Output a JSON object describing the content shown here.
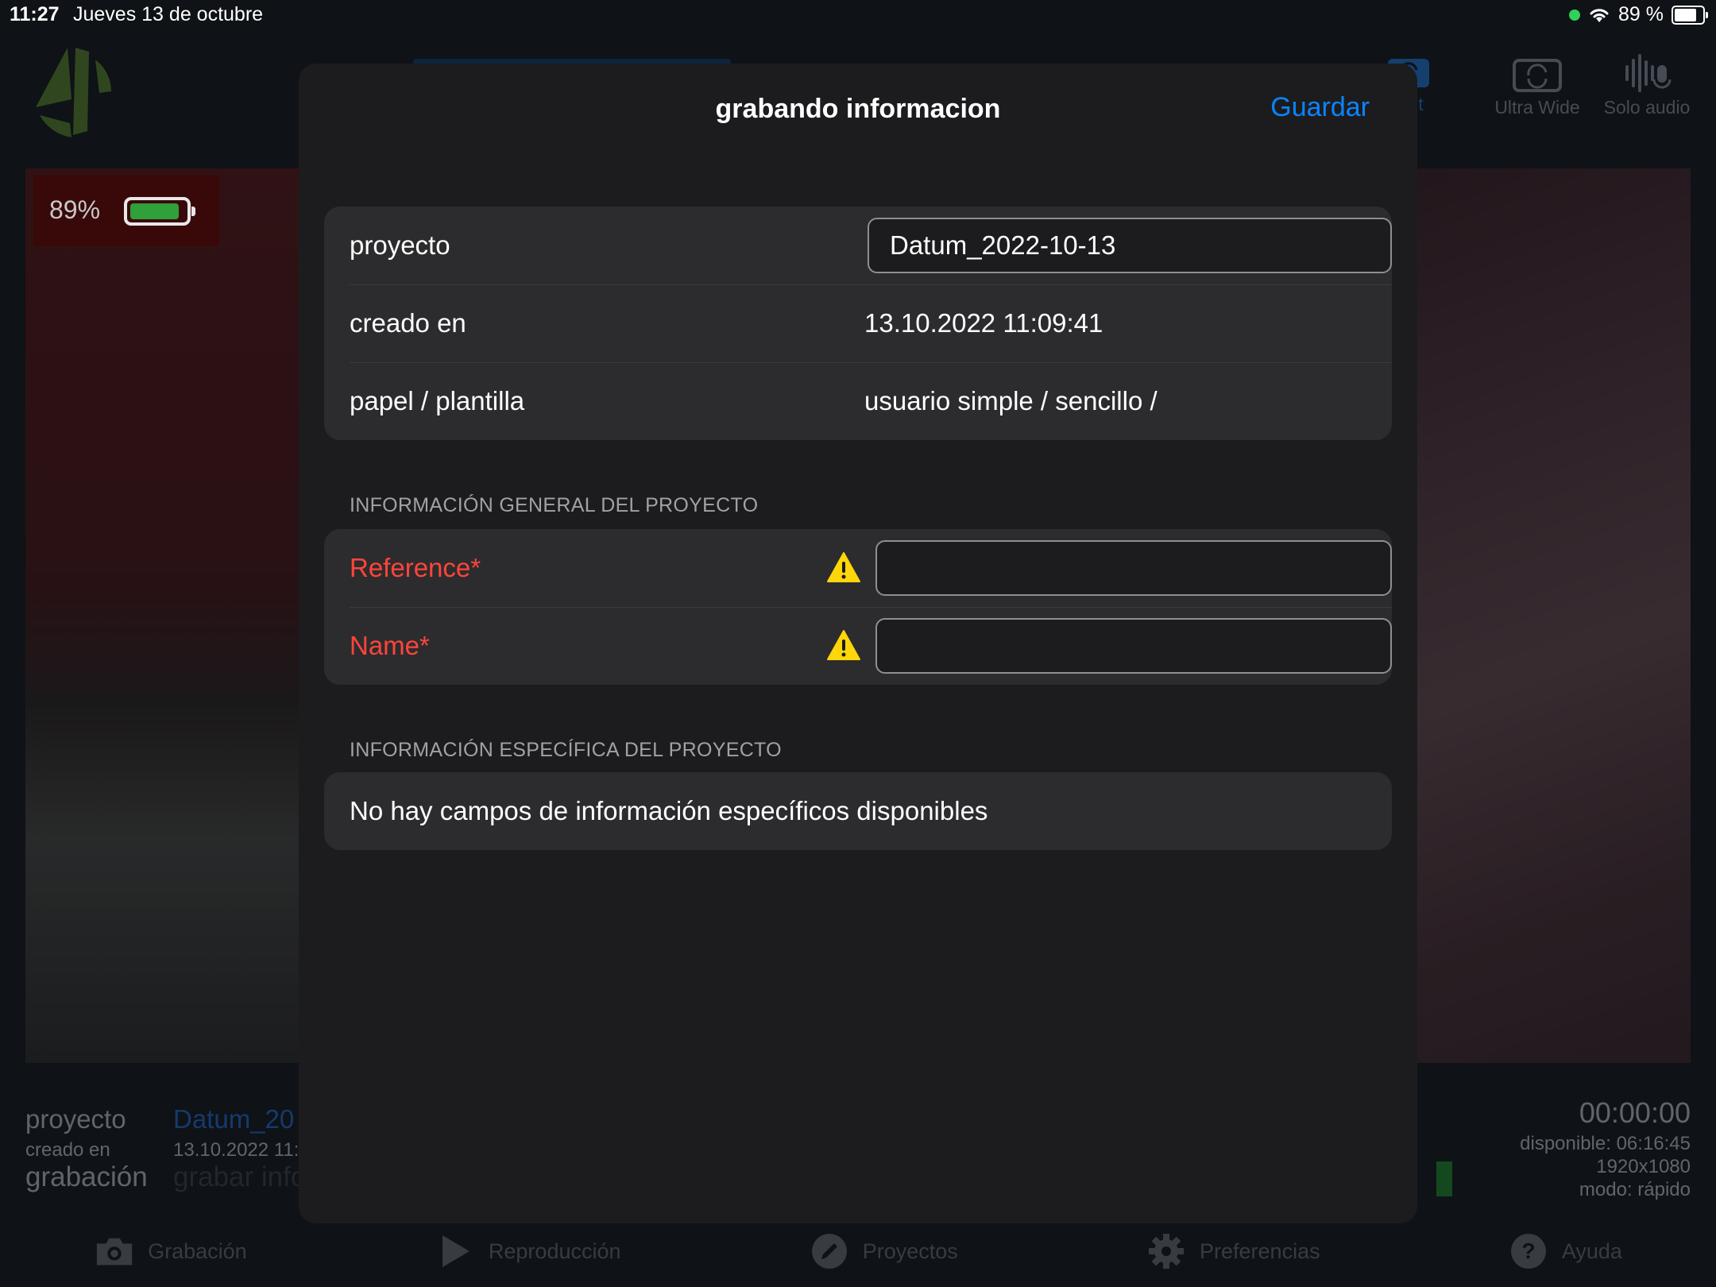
{
  "status_bar": {
    "time": "11:27",
    "date": "Jueves 13 de octubre",
    "battery_text": "89 %",
    "battery_level": 0.89
  },
  "camera": {
    "battery_percent": "89%",
    "battery_level": 0.89,
    "top_buttons": [
      {
        "label": "Front",
        "icon": "camera-flip-icon"
      },
      {
        "label": "Ultra Wide",
        "icon": "camera-flip-icon"
      },
      {
        "label": "Solo audio",
        "icon": "waveform-mic-icon"
      }
    ]
  },
  "project_info_bg": {
    "proyecto_label": "proyecto",
    "proyecto_value": "Datum_20",
    "creado_label": "creado en",
    "creado_value": "13.10.2022 11:",
    "grabacion_label": "grabación",
    "grabacion_value": "grabar info"
  },
  "recording_stats": {
    "time": "00:00:00",
    "available": "disponible: 06:16:45",
    "resolution": "1920x1080",
    "mode": "modo: rápido"
  },
  "tabs": [
    {
      "label": "Grabación",
      "icon": "camera-icon"
    },
    {
      "label": "Reproducción",
      "icon": "play-icon"
    },
    {
      "label": "Proyectos",
      "icon": "pencil-icon"
    },
    {
      "label": "Preferencias",
      "icon": "gear-icon"
    },
    {
      "label": "Ayuda",
      "icon": "help-icon"
    }
  ],
  "modal": {
    "title": "grabando informacion",
    "save_label": "Guardar",
    "summary": {
      "proyecto_label": "proyecto",
      "proyecto_value": "Datum_2022-10-13",
      "creado_label": "creado en",
      "creado_value": "13.10.2022 11:09:41",
      "papel_label": "papel / plantilla",
      "papel_value": "usuario simple / sencillo  /"
    },
    "general_header": "INFORMACIÓN GENERAL DEL PROYECTO",
    "general_fields": [
      {
        "label": "Reference*",
        "value": ""
      },
      {
        "label": "Name*",
        "value": ""
      }
    ],
    "specific_header": "INFORMACIÓN ESPECÍFICA DEL PROYECTO",
    "specific_empty": "No hay campos de información específicos disponibles"
  },
  "colors": {
    "accent": "#0a84ff",
    "required": "#ff453a",
    "warning": "#ffd60a",
    "battery_green": "#2fa03a"
  }
}
